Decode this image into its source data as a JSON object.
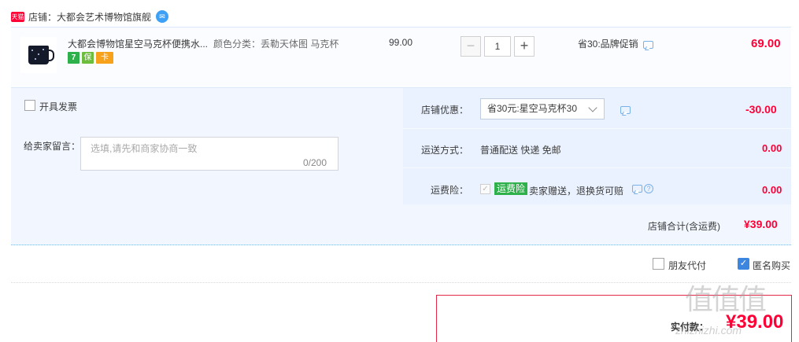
{
  "store": {
    "badge": "天猫",
    "label": "店铺：大都会艺术博物馆旗舰",
    "wangwang_icon": "wangwang-chat-icon"
  },
  "item": {
    "title": "大都会博物馆星空马克杯便携水...",
    "sku": "颜色分类：丢勒天体图 马克杯",
    "unit_price": "99.00",
    "quantity": "1",
    "qty_minus": "−",
    "qty_plus": "+",
    "promo": "省30:品牌促销",
    "total": "69.00",
    "service_badges": [
      "7",
      "保",
      "卡"
    ]
  },
  "options": {
    "invoice_label": "开具发票",
    "message_label": "给卖家留言：",
    "message_placeholder": "选填,请先和商家协商一致",
    "message_count": "0/200",
    "shop_discount_label": "店铺优惠：",
    "shop_discount_value": "省30元:星空马克杯30",
    "shop_discount_amount": "-30.00",
    "shipping_label": "运送方式：",
    "shipping_value": "普通配送 快递 免邮",
    "shipping_amount": "0.00",
    "insurance_label": "运费险：",
    "insurance_badge": "运费险",
    "insurance_desc": "卖家赠送，退换货可赔",
    "insurance_amount": "0.00",
    "subtotal_label": "店铺合计(含运费)",
    "subtotal_value": "¥39.00"
  },
  "footer": {
    "friend_pay_label": "朋友代付",
    "anonymous_label": "匿名购买",
    "pay_label": "实付款：",
    "pay_value": "¥39.00"
  },
  "watermark": {
    "main": "值值值",
    "sub": "zhizhizhi.com"
  },
  "colors": {
    "accent_red": "#ff0036",
    "panel_blue": "#f2f7ff",
    "checkbox_blue": "#3d86e0",
    "badge_green": "#2eb04a"
  }
}
